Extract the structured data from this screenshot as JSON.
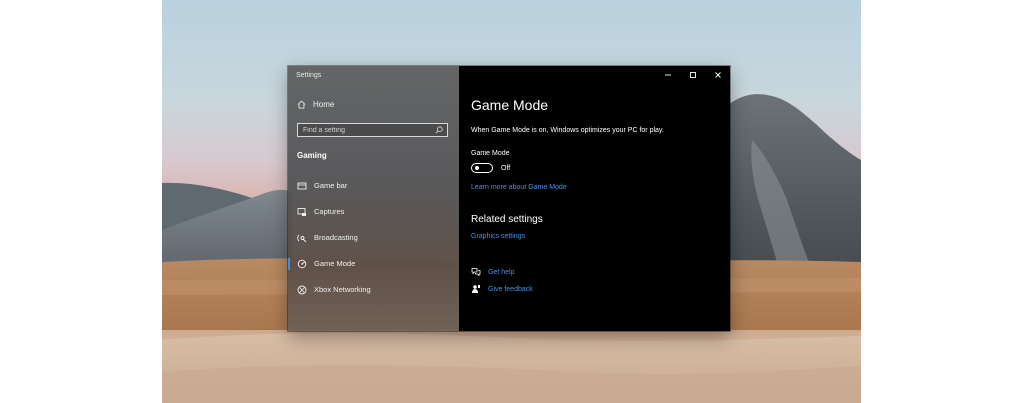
{
  "window": {
    "title": "Settings",
    "controls": [
      "minimize-icon",
      "maximize-icon",
      "close-icon"
    ]
  },
  "sidebar": {
    "home_label": "Home",
    "search_placeholder": "Find a setting",
    "section_title": "Gaming",
    "items": [
      {
        "label": "Game bar",
        "icon": "game-bar-icon",
        "selected": false
      },
      {
        "label": "Captures",
        "icon": "captures-icon",
        "selected": false
      },
      {
        "label": "Broadcasting",
        "icon": "broadcasting-icon",
        "selected": false
      },
      {
        "label": "Game Mode",
        "icon": "game-mode-icon",
        "selected": true
      },
      {
        "label": "Xbox Networking",
        "icon": "xbox-icon",
        "selected": false
      }
    ]
  },
  "content": {
    "title": "Game Mode",
    "description": "When Game Mode is on, Windows optimizes your PC for play.",
    "toggle_label": "Game Mode",
    "toggle_state": "Off",
    "learn_more": "Learn more about Game Mode",
    "related_title": "Related settings",
    "related_link": "Graphics settings",
    "get_help": "Get help",
    "give_feedback": "Give feedback"
  },
  "colors": {
    "accent_link": "#4c8fe8",
    "selection_bar": "#3b8eea",
    "content_bg": "#000000"
  }
}
